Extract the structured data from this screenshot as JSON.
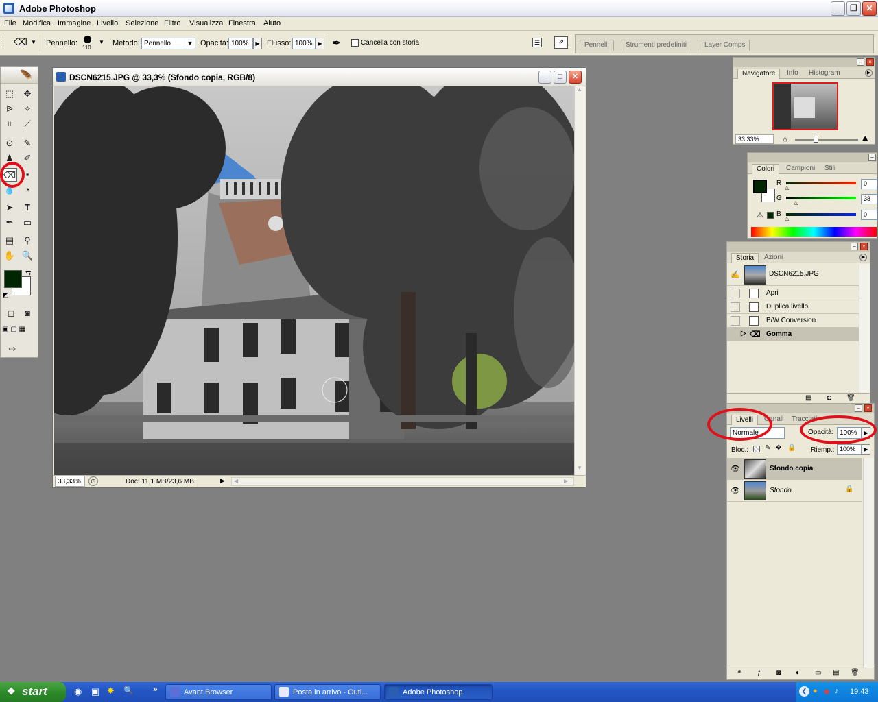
{
  "app": {
    "title": "Adobe Photoshop"
  },
  "menu": [
    "File",
    "Modifica",
    "Immagine",
    "Livello",
    "Selezione",
    "Filtro",
    "Visualizza",
    "Finestra",
    "Aiuto"
  ],
  "options": {
    "brush_label": "Pennello:",
    "brush_size": "110",
    "mode_label": "Metodo:",
    "mode_value": "Pennello",
    "opacity_label": "Opacità:",
    "opacity_value": "100%",
    "flow_label": "Flusso:",
    "flow_value": "100%",
    "erase_history_label": "Cancella con storia",
    "erase_history_checked": false
  },
  "palette_well": [
    "Pennelli",
    "Strumenti predefiniti",
    "Layer Comps"
  ],
  "document": {
    "title": "DSCN6215.JPG @ 33,3% (Sfondo copia, RGB/8)",
    "zoom": "33,33%",
    "doc_info": "Doc: 11,1 MB/23,6 MB"
  },
  "navigator": {
    "tabs": [
      "Navigatore",
      "Info",
      "Histogram"
    ],
    "zoom": "33.33%"
  },
  "colors": {
    "tabs": [
      "Colori",
      "Campioni",
      "Stili"
    ],
    "r_label": "R",
    "r_value": "0",
    "g_label": "G",
    "g_value": "38",
    "b_label": "B",
    "b_value": "0",
    "foreground": "#002600",
    "background": "#ffffff"
  },
  "history": {
    "tabs": [
      "Storia",
      "Azioni"
    ],
    "snapshot": "DSCN6215.JPG",
    "items": [
      "Apri",
      "Duplica livello",
      "B/W Conversion",
      "Gomma"
    ]
  },
  "layers": {
    "tabs": [
      "Livelli",
      "Canali",
      "Tracciati"
    ],
    "blend_mode": "Normale",
    "opacity_label": "Opacità:",
    "opacity_value": "100%",
    "lock_label": "Bloc.:",
    "fill_label": "Riemp.:",
    "fill_value": "100%",
    "items": [
      {
        "name": "Sfondo copia",
        "selected": true
      },
      {
        "name": "Sfondo",
        "locked": true
      }
    ]
  },
  "taskbar": {
    "start": "start",
    "items": [
      "Avant Browser",
      "Posta in arrivo - Outl...",
      "Adobe Photoshop"
    ],
    "clock": "19.43"
  },
  "accent_colors": {
    "annotation_red": "#e0101a",
    "xp_blue": "#2457c5",
    "selection": "#c6c3b4"
  }
}
